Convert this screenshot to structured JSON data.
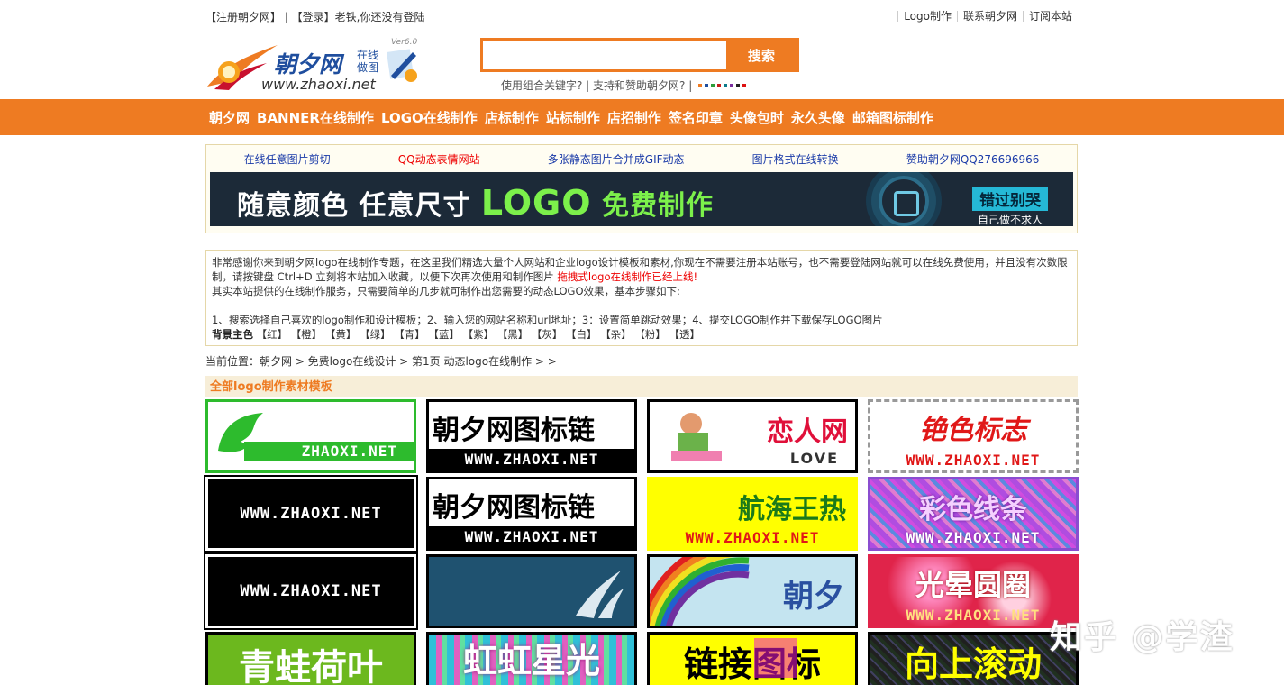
{
  "topbar": {
    "left": "【注册朝夕网】 | 【登录】老铁,你还没有登陆",
    "links": [
      "Logo制作",
      "联系朝夕网",
      "订阅本站"
    ]
  },
  "header": {
    "logo_main": "朝夕网",
    "logo_tag1": "在线",
    "logo_tag2": "做图",
    "logo_ver": "Ver6.0",
    "logo_url": "www.zhaoxi.net",
    "search_placeholder": "",
    "search_button": "搜索",
    "hint": "使用组合关键字? | 支持和赞助朝夕网? |",
    "swatch_colors": [
      "#ee7b22",
      "#1f4e9e",
      "#2d9c3a",
      "#c81d1d",
      "#0c7a8a",
      "#7a2da0",
      "#222222",
      "#d11"
    ]
  },
  "nav": [
    "朝夕网",
    "BANNER在线制作",
    "LOGO在线制作",
    "店标制作",
    "站标制作",
    "店招制作",
    "签名印章",
    "头像包时",
    "永久头像",
    "邮箱图标制作"
  ],
  "quicklinks": [
    {
      "label": "在线任意图片剪切",
      "color": "#1a3aa8"
    },
    {
      "label": "QQ动态表情网站",
      "color": "#e00"
    },
    {
      "label": "多张静态图片合并成GIF动态",
      "color": "#1a3aa8"
    },
    {
      "label": "图片格式在线转换",
      "color": "#1a3aa8"
    },
    {
      "label": "赞助朝夕网QQ276696966",
      "color": "#1a3aa8"
    }
  ],
  "banner": {
    "part1": "随意颜色 任意尺寸 ",
    "part2": "LOGO",
    "part3": " 免费制作",
    "tag": "错过别哭",
    "sub": "自己做不求人"
  },
  "intro": {
    "p1": "非常感谢你来到朝夕网logo在线制作专题，在这里我们精选大量个人网站和企业logo设计模板和素材,你现在不需要注册本站账号，也不需要登陆网站就可以在线免费使用，并且没有次数限制，请按键盘 Ctrl+D 立刻将本站加入收藏，以便下次再次使用和制作图片 ",
    "p1_red": "拖拽式logo在线制作已经上线!",
    "p2": "其实本站提供的在线制作服务，只需要简单的几步就可制作出您需要的动态LOGO效果，基本步骤如下:",
    "p3": "1、搜索选择自己喜欢的logo制作和设计模板；2、输入您的网站名称和url地址；3：设置简单跳动效果；4、提交LOGO制作并下载保存LOGO图片",
    "bg_label": "背景主色",
    "bg_colors": "【红】 【橙】 【黄】 【绿】 【青】 【蓝】 【紫】 【黑】 【灰】 【白】 【杂】 【粉】 【透】"
  },
  "breadcrumb": "当前位置：朝夕网 > 免费logo在线设计 > 第1页 动态logo在线制作 > >",
  "section_title": "全部logo制作素材模板",
  "tiles": [
    {
      "text": "ZHAOXI.NET",
      "bg": "#ffffff",
      "fg": "#2dbb2d",
      "border": "#2dbb2d",
      "kind": "dragon"
    },
    {
      "text": "朝夕网图标链",
      "sub": "WWW.ZHAOXI.NET",
      "bg": "#ffffff",
      "fg": "#000",
      "border": "#000",
      "kind": "chain"
    },
    {
      "text": "恋人网",
      "sub": "LOVE",
      "bg": "#ffffff",
      "fg": "#e0103a",
      "border": "#000",
      "kind": "love"
    },
    {
      "text": "铯色标志",
      "sub": "WWW.ZHAOXI.NET",
      "bg": "#ffffff",
      "fg": "#e01818",
      "border": "#888",
      "kind": "dash"
    },
    {
      "text": "WWW.ZHAOXI.NET",
      "bg": "#000000",
      "fg": "#ffffff",
      "border": "#fff",
      "kind": "black"
    },
    {
      "text": "朝夕网图标链",
      "sub": "WWW.ZHAOXI.NET",
      "bg": "#ffffff",
      "fg": "#000",
      "border": "#000",
      "kind": "chain2"
    },
    {
      "text": "航海王热",
      "sub": "WWW.ZHAOXI.NET",
      "bg": "#ffff00",
      "fg": "#1a7a1a",
      "border": "#ffff00",
      "kind": "yellow"
    },
    {
      "text": "彩色线条",
      "sub": "WWW.ZHAOXI.NET",
      "bg": "#8a4dd0",
      "fg": "#e8c5ff",
      "border": "#8a4dd0",
      "kind": "sparkle"
    },
    {
      "text": "WWW.ZHAOXI.NET",
      "bg": "#000000",
      "fg": "#ffffff",
      "border": "#fff",
      "kind": "black"
    },
    {
      "text": "",
      "bg": "#1f5270",
      "fg": "#ffffff",
      "border": "#000",
      "kind": "blue"
    },
    {
      "text": "朝夕",
      "bg": "#c4e4f0",
      "fg": "#2a50a0",
      "border": "#000",
      "kind": "rainbow"
    },
    {
      "text": "光晕圆圈",
      "sub": "WWW.ZHAOXI.NET",
      "bg": "#e0244a",
      "fg": "#ffffff",
      "border": "#e0244a",
      "kind": "halo"
    },
    {
      "text": "青蛙荷叶",
      "bg": "#6cb81e",
      "fg": "#ffffff",
      "border": "#000",
      "kind": "frog"
    },
    {
      "text": "虹虹星光",
      "bg": "#30c0d8",
      "fg": "#ffffff",
      "border": "#000",
      "kind": "star"
    },
    {
      "text": "链接图标",
      "bg": "#ffff00",
      "fg": "#000",
      "border": "#000",
      "kind": "link"
    },
    {
      "text": "向上滚动",
      "bg": "#202020",
      "fg": "#ffff00",
      "border": "#000",
      "kind": "scroll"
    }
  ],
  "watermark": "知乎 @学渣"
}
